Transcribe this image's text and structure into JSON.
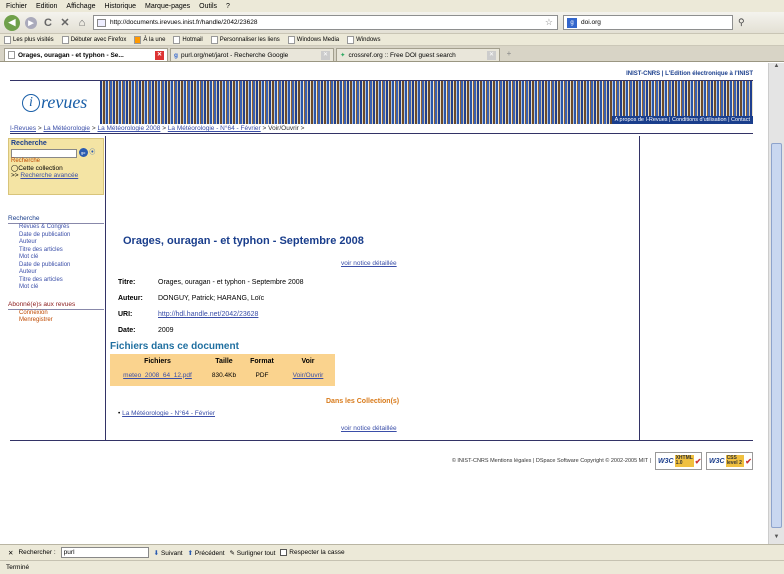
{
  "menu": [
    "Fichier",
    "Edition",
    "Affichage",
    "Historique",
    "Marque-pages",
    "Outils",
    "?"
  ],
  "nav": {
    "url": "http://documents.irevues.inist.fr/handle/2042/23628",
    "search_engine": "doi.org"
  },
  "bookmarks": [
    "Les plus visités",
    "Débuter avec Firefox",
    "À la une",
    "Hotmail",
    "Personnaliser les liens",
    "Windows Media",
    "Windows"
  ],
  "tabs": [
    {
      "label": "Orages, ouragan - et typhon - Se...",
      "active": true
    },
    {
      "label": "purl.org/net/jarot - Recherche Google",
      "active": false
    },
    {
      "label": "crossref.org :: Free DOI guest search",
      "active": false
    }
  ],
  "site": {
    "top_links": "INIST-CNRS | L'Edition électronique à l'INIST",
    "logo_text": "revues",
    "logo_letter": "i",
    "banner_links": "A propos de I-Revues | Conditions d'utilisation | Contact",
    "breadcrumb": [
      "I-Revues",
      "La Météorologie",
      "La Météorologie 2008",
      "La Météorologie - N°64 - Février",
      "Voir/Ouvrir"
    ],
    "sep": ">"
  },
  "sidebar": {
    "search_title": "Recherche",
    "search_label": "Recherche",
    "radio_label": "Cette collection",
    "advanced_prefix": ">>",
    "advanced_link": "Recherche avancée",
    "browse_title": "Recherche",
    "browse_items": [
      "Revues & Congrès",
      "Date de publication",
      "Auteur",
      "Titre des articles",
      "Mot clé",
      "Date de publication",
      "Auteur",
      "Titre des articles",
      "Mot clé"
    ],
    "subscribers_title": "Abonné(e)s aux revues",
    "subscribers_items": [
      "Connexion",
      "Menregistrer"
    ]
  },
  "main": {
    "title": "Orages, ouragan - et typhon - Septembre 2008",
    "notice_link": "voir notice détaillée",
    "meta": [
      {
        "k": "Titre:",
        "v": "Orages, ouragan - et typhon - Septembre 2008"
      },
      {
        "k": "Auteur:",
        "v": "DONGUY, Patrick; HARANG, Loïc"
      },
      {
        "k": "URI:",
        "v": "http://hdl.handle.net/2042/23628"
      },
      {
        "k": "Date:",
        "v": "2009"
      }
    ],
    "files_heading": "Fichiers dans ce document",
    "files_headers": [
      "Fichiers",
      "Taille",
      "Format",
      "Voir"
    ],
    "files_row": {
      "name": "meteo_2008_64_12.pdf",
      "size": "830.4Kb",
      "format": "PDF",
      "view": "Voir/Ouvrir"
    },
    "collections_heading": "Dans les Collection(s)",
    "collections_item": "La Météorologie - N°64 - Février",
    "notice_link_bottom": "voir notice détaillée"
  },
  "footer": {
    "text": "© INIST-CNRS Mentions légales | DSpace Software Copyright © 2002-2005 MIT |",
    "badge1": {
      "w3": "W3C",
      "label": "XHTML 1.0"
    },
    "badge2": {
      "w3": "W3C",
      "label": "CSS level 2"
    }
  },
  "findbar": {
    "label": "Rechercher :",
    "value": "purl",
    "next": "Suivant",
    "prev": "Précédent",
    "highlight": "Surligner tout",
    "match_case": "Respecter la casse"
  },
  "status": "Terminé"
}
